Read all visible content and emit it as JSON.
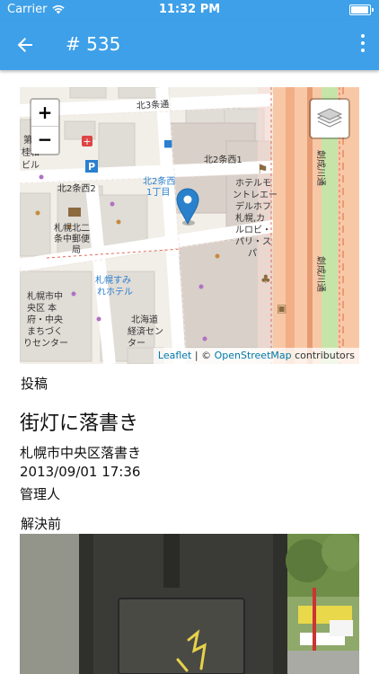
{
  "status_bar": {
    "carrier": "Carrier",
    "time": "11:32 PM"
  },
  "app_bar": {
    "title": "# 535",
    "back_icon": "arrow-left-icon",
    "menu_icon": "more-vertical-icon"
  },
  "map": {
    "zoom_in": "+",
    "zoom_out": "−",
    "attribution": {
      "leaflet": "Leaflet",
      "separator": " | © ",
      "osm": "OpenStreetMap",
      "suffix": " contributors"
    },
    "labels": {
      "kita3": "北3条通",
      "kita2_nishi1": "北2条西1",
      "kita2_nishi2": "北2条西2",
      "kita2_nishi1_1chome": "北2条西",
      "chome": "1丁目",
      "p": "P",
      "hotel1": "ホテルモ",
      "hotel2": "ントレエー",
      "hotel3": "デルホフ",
      "hotel4": "札幌,カ",
      "hotel5": "ルロビ・",
      "hotel6": "パリ・ス",
      "hotel7": "パ",
      "post1": "札幌北二",
      "post2": "条中郵便",
      "post3": "局",
      "sumire1": "札幌すみ",
      "sumire2": "れホテル",
      "center1": "札幌市中",
      "center2": "央区 本",
      "center3": "府・中央",
      "center4": "まちづく",
      "center5": "りセンター",
      "keizai1": "北海道",
      "keizai2": "経済セン",
      "keizai3": "ター",
      "left1": "第",
      "left2": "桂和",
      "left3": "ビル",
      "sosei1": "創成川通",
      "sosei2": "創成川通"
    }
  },
  "post": {
    "section_label": "投稿",
    "title": "街灯に落書き",
    "location": "札幌市中央区落書き",
    "datetime": "2013/09/01 17:36",
    "author": "管理人"
  },
  "before_label": "解決前",
  "colors": {
    "primary": "#3ea0e8",
    "marker": "#2a81cb"
  }
}
